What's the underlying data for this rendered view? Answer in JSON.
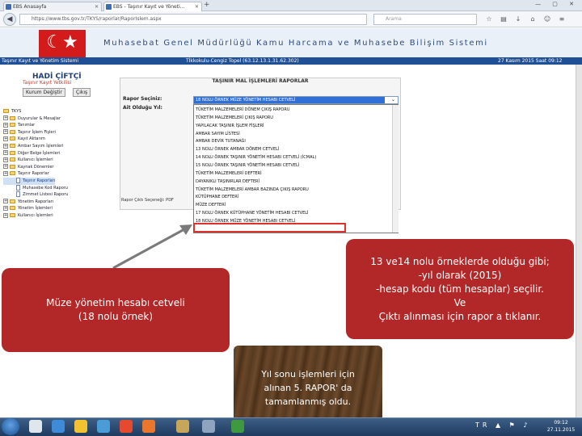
{
  "browser": {
    "tabs": [
      {
        "label": "EBS Anasayfa"
      },
      {
        "label": "EBS - Taşınır Kayıt ve Yöneti..."
      }
    ],
    "url": "https://www.tbs.gov.tr/TKYS/raporlar/RaporIslem.aspx",
    "search_placeholder": "Arama"
  },
  "site": {
    "title": "Muhasebat Genel Müdürlüğü Kamu Harcama ve Muhasebe Bilişim Sistemi",
    "bar_left": "Taşınır Kayıt ve Yönetim Sistemi",
    "bar_center": "Tİkkokulu-Cengiz Topel (63.12.13.1.31.62.302)",
    "bar_right": "27 Kasım 2015 Saat 09:12"
  },
  "user": {
    "name": "HADİ ÇİFTÇİ",
    "subtitle": "Taşınır Kayıt Yetkilisi",
    "buttons": [
      "Kurum Değiştir",
      "Çıkış"
    ]
  },
  "tree": [
    {
      "label": "TKYS",
      "type": "root"
    },
    {
      "label": "Duyurular & Mesajlar",
      "type": "folder"
    },
    {
      "label": "Tanımlar",
      "type": "folder"
    },
    {
      "label": "Taşınır İşlem Fişleri",
      "type": "folder"
    },
    {
      "label": "Kayıt Aktarım",
      "type": "folder"
    },
    {
      "label": "Ambar Sayım İşlemleri",
      "type": "folder"
    },
    {
      "label": "Diğer Belge İşlemleri",
      "type": "folder"
    },
    {
      "label": "Kullanıcı İşlemleri",
      "type": "folder"
    },
    {
      "label": "Kaynak Dönemler",
      "type": "folder"
    },
    {
      "label": "Taşınır Raporlar",
      "type": "folder"
    },
    {
      "label": "Taşınır Raporları",
      "type": "doc",
      "selected": true
    },
    {
      "label": "Muhasebe Kod Raporu",
      "type": "doc"
    },
    {
      "label": "Zimmet Listesi Raporu",
      "type": "doc"
    },
    {
      "label": "Yönetim Raporları",
      "type": "folder"
    },
    {
      "label": "Yönetim İşlemleri",
      "type": "folder"
    },
    {
      "label": "Kullanıcı İşlemleri",
      "type": "folder"
    }
  ],
  "form": {
    "title": "TAŞINIR MAL İŞLEMLERİ RAPORLAR",
    "rapor_label": "Rapor Seçiniz:",
    "yil_label": "Ait Olduğu Yıl:",
    "cikti_label": "Rapor Çıktı Seçeneği: PDF",
    "selected_value": "18 NOLU ÖRNEK MÜZE YÖNETİM HESABI CETVELİ",
    "options": [
      "TÜKETİM MALZEMELERİ DÖNEM ÇIKIŞ RAPORU",
      "TÜKETİM MALZEMELERİ ÇIKIŞ RAPORU",
      "YAPILACAK TAŞINIR İŞLEM FİŞLERİ",
      "AMBAR SAYIM LİSTESİ",
      "AMBAR DEVİR TUTANAĞI",
      "13 NOLU ÖRNEK AMBAR DÖNEM CETVELİ",
      "14 NOLU ÖRNEK TAŞINIR YÖNETİM HESABI CETVELİ (İCMAL)",
      "15 NOLU ÖRNEK TAŞINIR YÖNETİM HESABI CETVELİ",
      "TÜKETİM MALZEMELERİ DEFTERİ",
      "DAYANIKLI TAŞINIRLAR DEFTERİ",
      "TÜKETİM MALZEMELERİ AMBAR BAZINDA ÇIKIŞ RAPORU",
      "KÜTÜPHANE DEFTERİ",
      "MÜZE DEFTERİ",
      "17 NOLU ÖRNEK KÜTÜPHANE YÖNETİM HESABI CETVELİ",
      "18 NOLU ÖRNEK MÜZE YÖNETİM HESABI CETVELİ"
    ]
  },
  "callouts": {
    "left": "Müze yönetim hesabı cetveli\n(18 nolu örnek)",
    "right": "13 ve14 nolu örneklerde  olduğu gibi;\n-yıl olarak (2015)\n-hesap kodu (tüm hesaplar) seçilir.\nVe\nÇıktı alınması için  rapor a tıklanır.",
    "wood": "Yıl sonu işlemleri için\nalınan 5. RAPOR' da\ntamamlanmış oldu."
  },
  "taskbar": {
    "clock_time": "09:12",
    "clock_date": "27.11.2015",
    "tray": "TR ▲ ⚑ ♪"
  },
  "colors": {
    "brand_blue": "#1f4f95",
    "callout_red": "#b22727",
    "highlight_red": "#e0302a"
  }
}
